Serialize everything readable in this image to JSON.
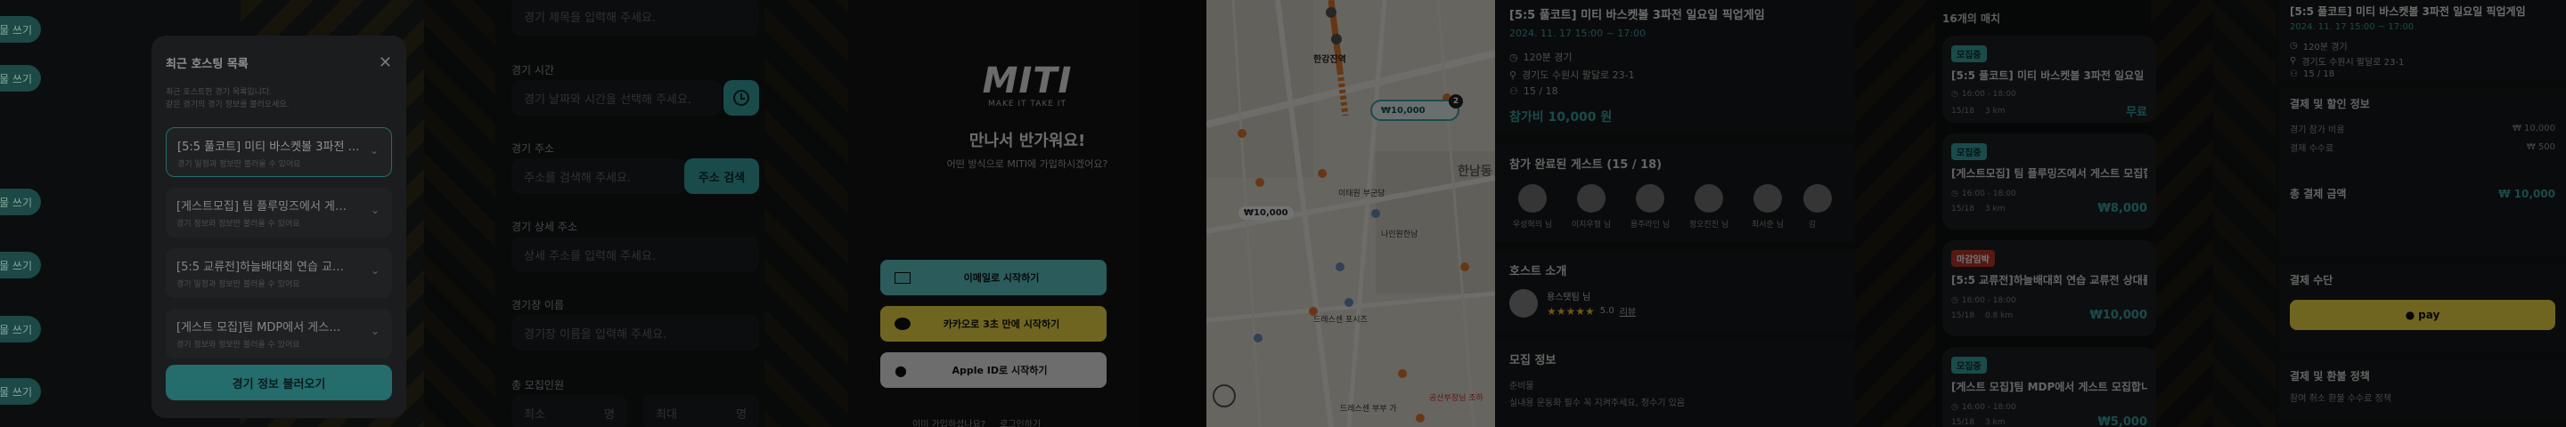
{
  "panel1": {
    "left_chips": [
      "물 쓰기",
      "물 쓰기",
      "물 쓰기",
      "물 쓰기",
      "물 쓰기",
      "물 쓰기"
    ],
    "modal_title": "최근 호스팅 목록",
    "modal_desc_1": "최근 호스트한 경기 목록입니다.",
    "modal_desc_2": "같은 경기의 경기 정보를 불러오세요.",
    "items": [
      {
        "title": "[5:5 풀코트] 미티 바스켓볼 3파전 …",
        "sub": "경기 일정과 정보만 불러올 수 있어요"
      },
      {
        "title": "[게스트모집] 팀 플루밍즈에서 게…",
        "sub": "경기 정보와 정보만 불러올 수 있어요"
      },
      {
        "title": "[5:5 교류전]하늘배대회 연습 교…",
        "sub": "경기 일정과 정보만 불러올 수 있어요"
      },
      {
        "title": "[게스트 모집]팀 MDP에서 게스…",
        "sub": "경기 정보와 정보만 불러올 수 있어요"
      }
    ],
    "load_button": "경기 정보 불러오기"
  },
  "panel2": {
    "top_placeholder": "경기 제목을 입력해 주세요.",
    "time_label": "경기 시간",
    "time_placeholder": "경기 날짜와 시간을 선택해 주세요.",
    "addr_label": "경기 주소",
    "addr_placeholder": "주소를 검색해 주세요.",
    "addr_button": "주소 검색",
    "detail_label": "경기 상세 주소",
    "detail_placeholder": "상세 주소를 입력해 주세요.",
    "venue_label": "경기장 이름",
    "venue_placeholder": "경기장 이름을 입력해 주세요.",
    "total_label": "총 모집인원",
    "min_label": "최소",
    "min_unit": "명",
    "max_label": "최대",
    "max_unit": "명"
  },
  "panel3": {
    "logo": "MITI",
    "tagline": "MAKE IT TAKE IT",
    "greeting": "만나서 반가워요!",
    "question": "어떤 방식으로 MITI에 가입하시겠어요?",
    "email_button": "이메일로 시작하기",
    "kakao_button": "카카오로 3초 만에 시작하기",
    "apple_button": "Apple ID로 시작하기",
    "footer_left": "이미 가입하셨나요?",
    "footer_right": "로그인하기"
  },
  "panel4": {
    "station_label": "한강진역",
    "price_marker": "₩10,000",
    "price_marker_count": "2",
    "price_small": "₩10,000",
    "hannam": "한남동",
    "place_1": "이태원 부군당",
    "place_2": "나인원한남",
    "place_3": "드레스센 포시즈",
    "place_4": "드레스센 부부 가",
    "place_5": "공산부장님 조하"
  },
  "panel5": {
    "title": "[5:5 풀코트] 미티 바스켓볼 3파전 일요일 픽업게임",
    "date": "2024. 11. 17 15:00 ~ 17:00",
    "duration": "120분 경기",
    "address": "경기도 수원시 팔달로 23-1",
    "count": "15 / 18",
    "fee": "참가비 10,000 원",
    "guests_title": "참가 완료된 게스트 (15 / 18)",
    "guests": [
      "우성혁의 님",
      "이지우형 님",
      "용주라인 님",
      "정오진진 님",
      "최서준 님",
      "김"
    ],
    "host_title": "호스트 소개",
    "host_name": "용스탯팀 님",
    "host_rating": "5.0",
    "host_reviews": "리뷰",
    "recruit_title": "모집 정보",
    "recruit_sub": "준비물",
    "recruit_text": "실내용 운동화 필수 꼭 지켜주세요, 정수기 있음"
  },
  "panel6": {
    "count_title": "16개의 매치",
    "matches": [
      {
        "tag": "모집중",
        "title": "[5:5 풀코트] 미티 바스켓볼 3파전 일요일 픽…",
        "time": "16:00 - 18:00",
        "people": "15/18",
        "dist": "3 km",
        "price": "무료"
      },
      {
        "tag": "모집중",
        "title": "[게스트모집] 팀 플루밍즈에서 게스트 모집합…",
        "time": "16:00 - 18:00",
        "people": "15/18",
        "dist": "3 km",
        "price": "₩8,000"
      },
      {
        "tag": "마감임박",
        "title": "[5:5 교류전]하늘배대회 연습 교류전 상대를…",
        "time": "16:00 - 18:00",
        "people": "15/18",
        "dist": "0.8 km",
        "price": "₩10,000"
      },
      {
        "tag": "모집중",
        "title": "[게스트 모집]팀 MDP에서 게스트 모집합니다",
        "time": "16:00 - 18:00",
        "people": "15/18",
        "dist": "3 km",
        "price": "₩5,000"
      }
    ]
  },
  "panel7": {
    "title": "[5:5 풀코트] 미티 바스켓볼 3파전 일요일 픽업게임",
    "date": "2024. 11. 17 15:00 ~ 17:00",
    "duration": "120분 경기",
    "address": "경기도 수원시 팔달로 23-1",
    "count": "15 / 18",
    "pay_title": "결제 및 할인 정보",
    "fee_label": "경기 참가 비용",
    "fee_value": "₩ 10,000",
    "service_label": "결제 수수료",
    "service_value": "₩ 500",
    "total_label": "총 결제 금액",
    "total_value": "₩ 10,000",
    "method_title": "결제 수단",
    "method_label": "pay",
    "policy_title": "결제 및 환불 정책",
    "policy_text": "참여 취소 환불 수수료 정책"
  },
  "colors": {
    "accent": "#3aa6a6",
    "kakao": "#f7e14a",
    "red_tag": "#c0392b"
  }
}
